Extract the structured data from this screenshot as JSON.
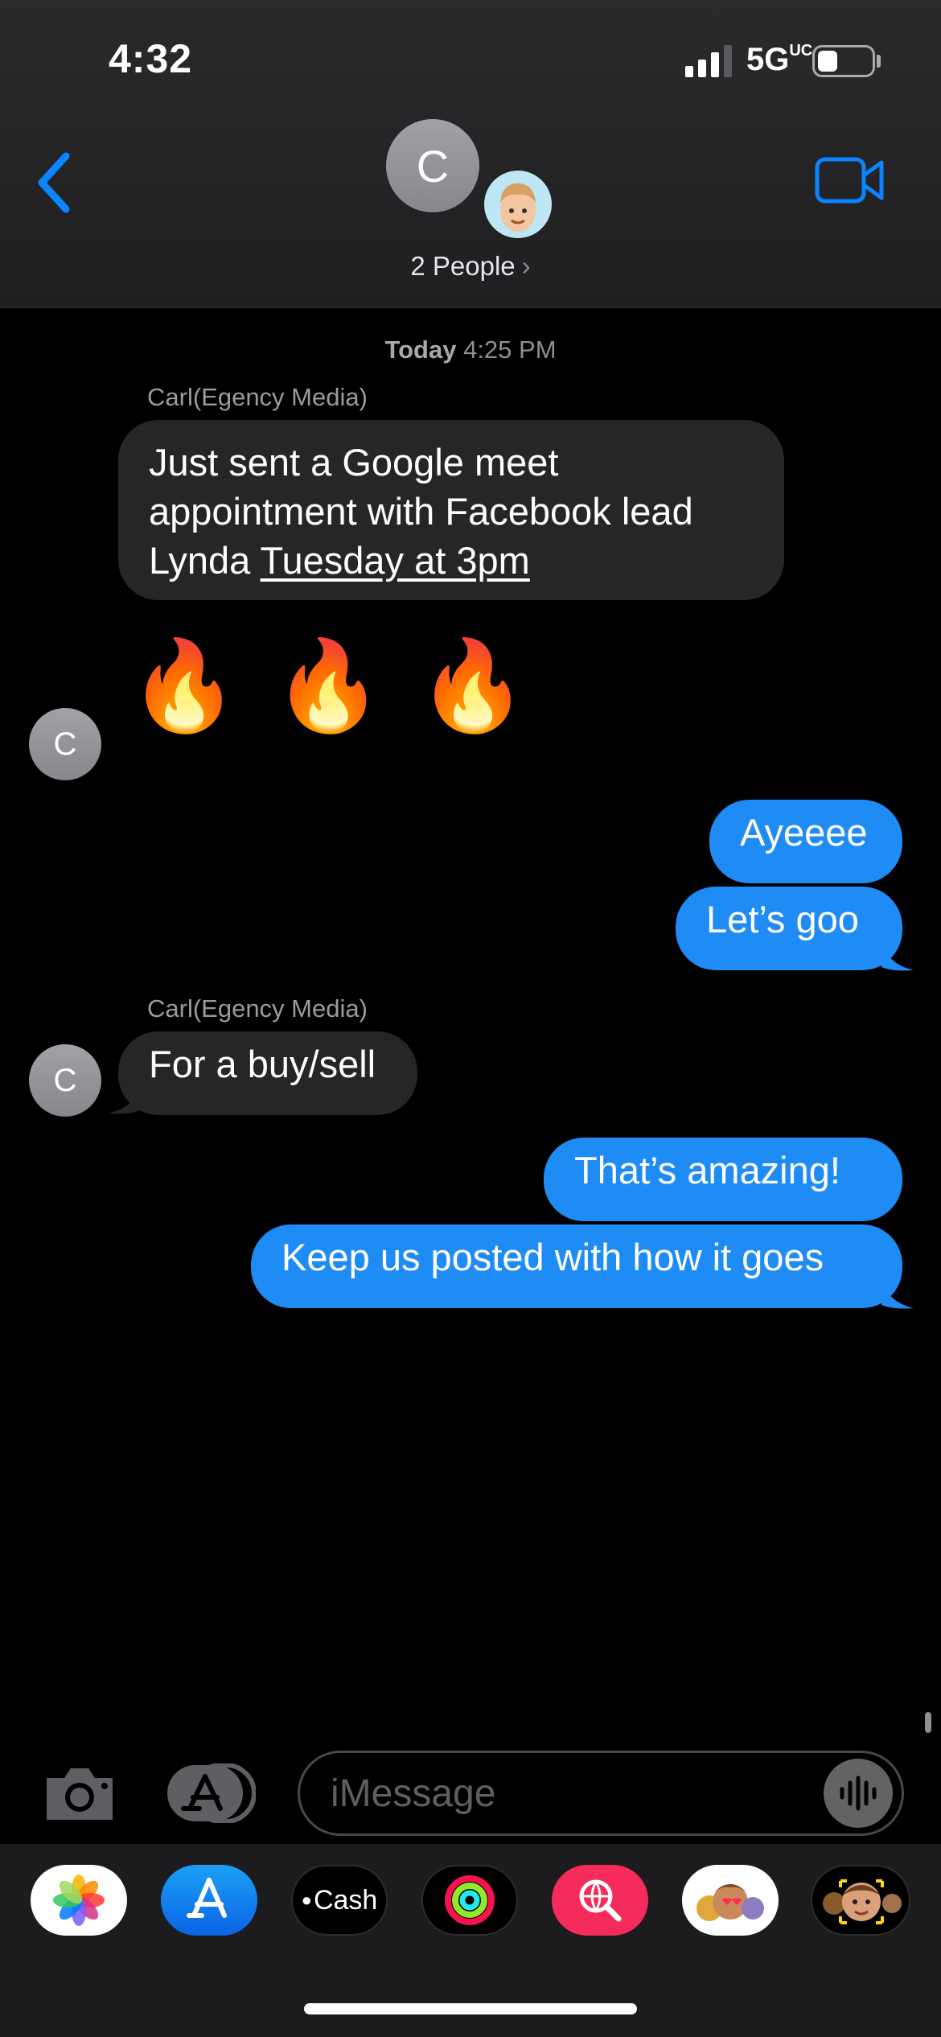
{
  "status_bar": {
    "time": "4:32",
    "network": "5G",
    "network_suffix": "UC"
  },
  "header": {
    "group_initial": "C",
    "people_label": "2 People",
    "chevron": "›"
  },
  "conversation": {
    "timestamp_day": "Today",
    "timestamp_time": "4:25 PM",
    "messages": [
      {
        "sender": "Carl(Egency Media)",
        "text_a": "Just sent a Google meet appointment with Facebook lead Lynda ",
        "text_link": "Tuesday at 3pm"
      },
      {
        "emoji": "🔥 🔥 🔥"
      },
      {
        "text": "Ayeeee"
      },
      {
        "text": "Let’s goo"
      },
      {
        "sender": "Carl(Egency Media)",
        "text": "For a buy/sell"
      },
      {
        "text": "That’s amazing!"
      },
      {
        "text": "Keep us posted with how it goes"
      }
    ],
    "avatar_initial": "C"
  },
  "input": {
    "placeholder": "iMessage"
  },
  "drawer": {
    "cash_label": "Cash",
    "apps": [
      "photos-icon",
      "app-store-icon",
      "apple-cash-icon",
      "activity-icon",
      "web-search-icon",
      "memoji-stickers-icon",
      "animoji-icon"
    ]
  },
  "colors": {
    "outgoing": "#1f8bf5",
    "incoming": "#262628",
    "accent": "#0a84ff"
  }
}
